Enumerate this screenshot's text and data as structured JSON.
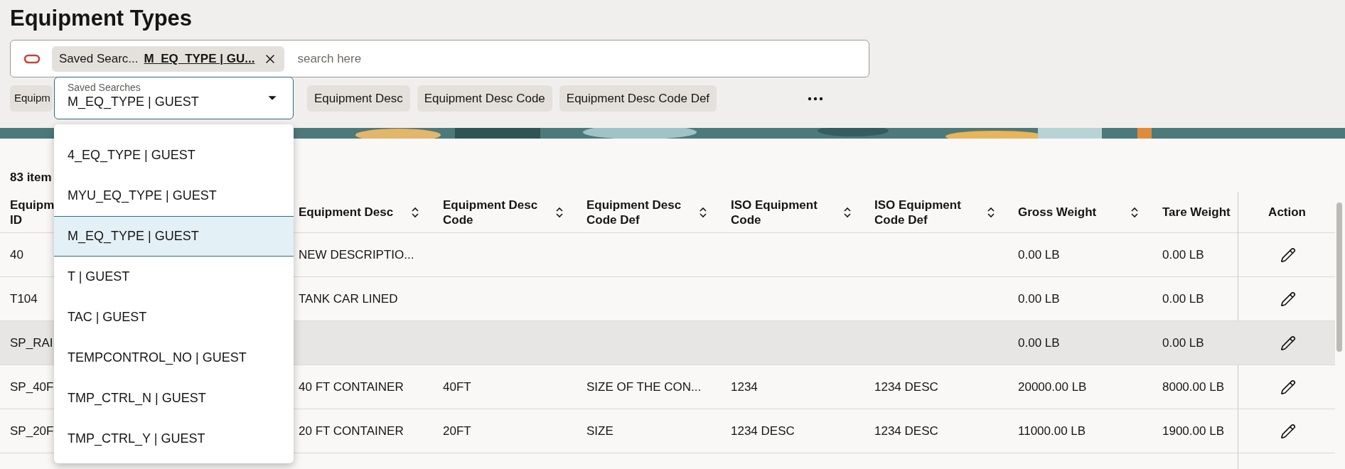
{
  "page_title": "Equipment Types",
  "search_bar": {
    "chip": {
      "label": "Saved Searc...",
      "value": "M_EQ_TYPE | GU..."
    },
    "placeholder": "search here"
  },
  "filter_chips": [
    {
      "label": "Equipm"
    },
    {
      "label": "Equipment Desc"
    },
    {
      "label": "Equipment Desc Code"
    },
    {
      "label": "Equipment Desc Code Def"
    }
  ],
  "item_count": "83 item",
  "table": {
    "columns": [
      {
        "label": "Equipm ID"
      },
      {
        "label": "Equipment Desc",
        "sortable": true
      },
      {
        "label": "Equipment Desc Code",
        "sortable": true
      },
      {
        "label": "Equipment Desc Code Def",
        "sortable": true
      },
      {
        "label": "ISO Equipment Code",
        "sortable": true
      },
      {
        "label": "ISO Equipment Code Def",
        "sortable": true
      },
      {
        "label": "Gross Weight",
        "sortable": true
      },
      {
        "label": "Tare Weight",
        "sortable": false
      },
      {
        "label": "Action",
        "sortable": false
      }
    ],
    "rows": [
      {
        "cells": [
          "40",
          "NEW DESCRIPTIO...",
          null,
          null,
          null,
          null,
          "0.00 LB",
          "0.00 LB"
        ],
        "highlighted": false
      },
      {
        "cells": [
          "T104",
          "TANK CAR LINED",
          null,
          null,
          null,
          null,
          "0.00 LB",
          "0.00 LB"
        ],
        "highlighted": false
      },
      {
        "cells": [
          "SP_RAI",
          null,
          null,
          null,
          null,
          null,
          "0.00 LB",
          "0.00 LB"
        ],
        "highlighted": true
      },
      {
        "cells": [
          "SP_40F",
          "40 FT CONTAINER",
          "40FT",
          "SIZE OF THE CON...",
          "1234",
          "1234 DESC",
          "20000.00 LB",
          "8000.00 LB"
        ],
        "highlighted": false
      },
      {
        "cells": [
          "SP_20F",
          "20 FT CONTAINER",
          "20FT",
          "SIZE",
          "1234 DESC",
          "1234 DESC",
          "11000.00 LB",
          "1900.00 LB"
        ],
        "highlighted": false
      }
    ]
  },
  "saved_searches": {
    "label": "Saved Searches",
    "value": "M_EQ_TYPE | GUEST",
    "options": [
      {
        "label": "4_EQ_TYPE | GUEST",
        "selected": false
      },
      {
        "label": "MYU_EQ_TYPE | GUEST",
        "selected": false
      },
      {
        "label": "M_EQ_TYPE | GUEST",
        "selected": true
      },
      {
        "label": "T | GUEST",
        "selected": false
      },
      {
        "label": "TAC | GUEST",
        "selected": false
      },
      {
        "label": "TEMPCONTROL_NO | GUEST",
        "selected": false
      },
      {
        "label": "TMP_CTRL_N | GUEST",
        "selected": false
      },
      {
        "label": "TMP_CTRL_Y | GUEST",
        "selected": false
      }
    ]
  }
}
